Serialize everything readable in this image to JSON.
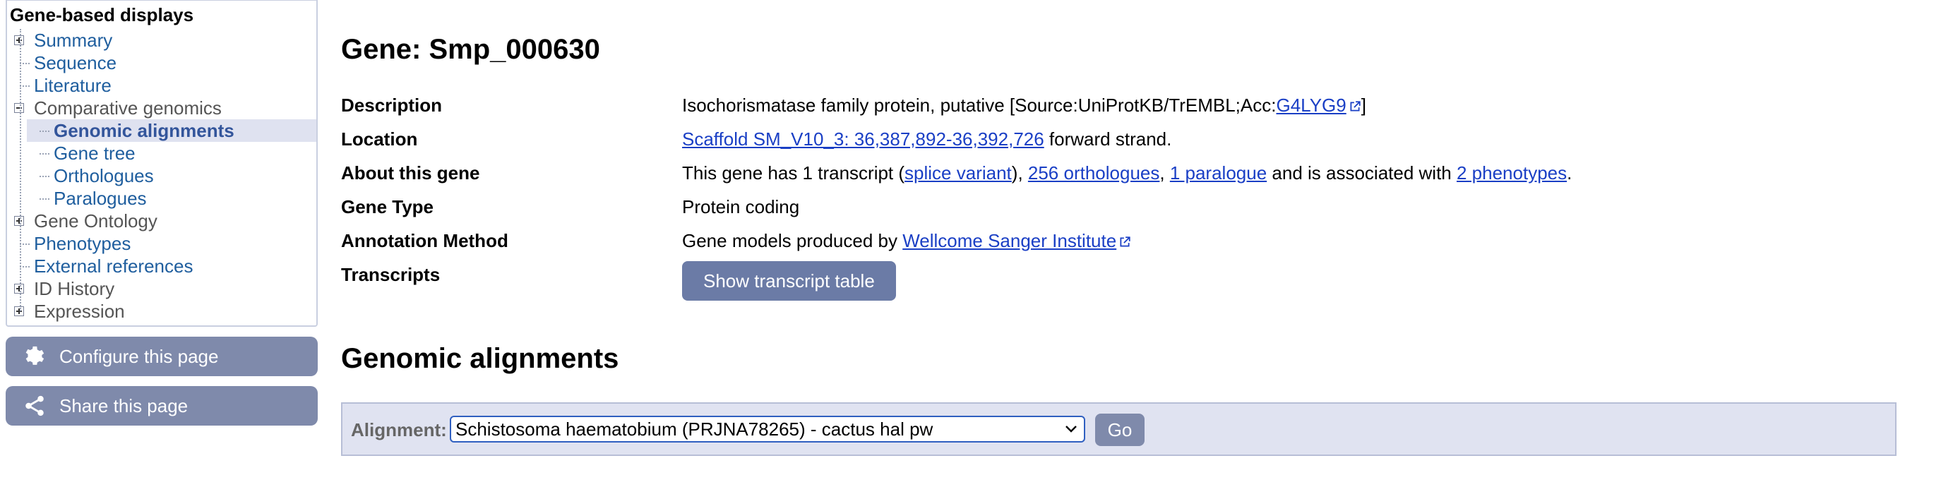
{
  "sidebar": {
    "header": "Gene-based displays",
    "items": [
      {
        "label": "Summary",
        "toggle": "plus"
      },
      {
        "label": "Sequence"
      },
      {
        "label": "Literature"
      },
      {
        "label": "Comparative genomics",
        "toggle": "minus"
      },
      {
        "label": "Genomic alignments",
        "active": true
      },
      {
        "label": "Gene tree"
      },
      {
        "label": "Orthologues"
      },
      {
        "label": "Paralogues"
      },
      {
        "label": "Gene Ontology",
        "toggle": "plus"
      },
      {
        "label": "Phenotypes"
      },
      {
        "label": "External references"
      },
      {
        "label": "ID History",
        "toggle": "plus"
      },
      {
        "label": "Expression",
        "toggle": "plus"
      }
    ],
    "configure_label": "Configure this page",
    "share_label": "Share this page"
  },
  "gene": {
    "title": "Gene: Smp_000630",
    "description_label": "Description",
    "description_text": "Isochorismatase family protein, putative [Source:UniProtKB/TrEMBL;Acc:",
    "description_link": "G4LYG9",
    "description_end": "]",
    "location_label": "Location",
    "location_link": "Scaffold SM_V10_3: 36,387,892-36,392,726",
    "location_suffix": " forward strand.",
    "about_label": "About this gene",
    "about_prefix": "This gene has 1 transcript (",
    "about_splice": "splice variant",
    "about_sep1": "), ",
    "about_orthologues": "256 orthologues",
    "about_sep2": ", ",
    "about_paralogue": "1 paralogue",
    "about_sep3": " and is associated with ",
    "about_phenotypes": "2 phenotypes",
    "about_end": ".",
    "type_label": "Gene Type",
    "type_value": "Protein coding",
    "annotation_label": "Annotation Method",
    "annotation_prefix": "Gene models produced by ",
    "annotation_link": "Wellcome Sanger Institute",
    "transcripts_label": "Transcripts",
    "transcript_button": "Show transcript table"
  },
  "alignments": {
    "title": "Genomic alignments",
    "label": "Alignment:",
    "selected": "Schistosoma haematobium (PRJNA78265) - cactus hal pw",
    "go_label": "Go"
  },
  "colors": {
    "link": "#1a3fc5",
    "nav_link": "#1f5e9e",
    "button": "#7f8aab",
    "bar_bg": "#e0e3f1"
  }
}
